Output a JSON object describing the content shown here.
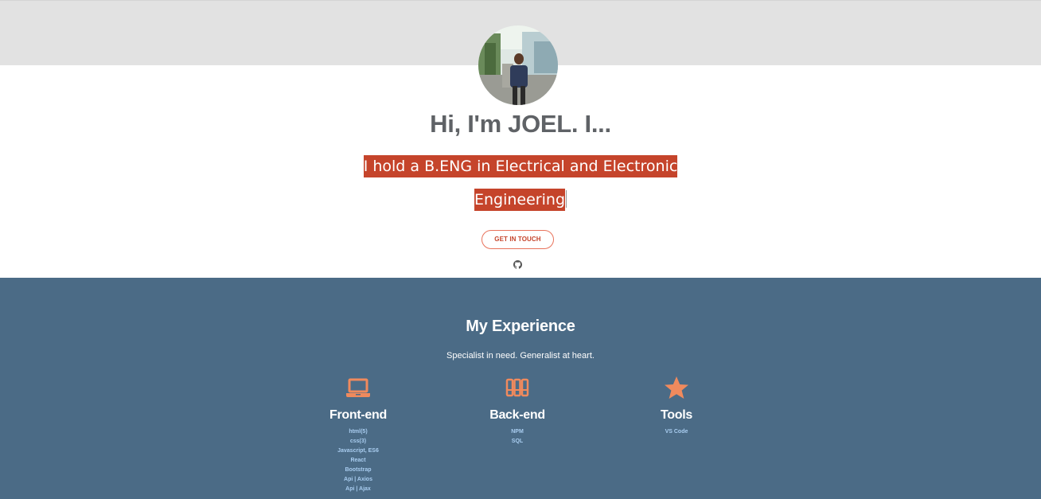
{
  "hero": {
    "greeting": "Hi, I'm JOEL. I...",
    "typed_line1": "I hold a B.ENG in Electrical and Electronic",
    "typed_line2": "Engineering",
    "cta_label": "GET IN TOUCH",
    "accent_color": "#c5442b"
  },
  "icons": {
    "avatar": "profile-photo",
    "social": "github-icon"
  },
  "experience": {
    "title": "My Experience",
    "subtitle": "Specialist in need. Generalist at heart.",
    "background": "#4b6b86",
    "columns": [
      {
        "icon": "laptop-icon",
        "heading": "Front-end",
        "items": [
          "html(5)",
          "css(3)",
          "Javascript, ES6",
          "React",
          "Bootstrap",
          "Api | Axios",
          "Api | Ajax"
        ]
      },
      {
        "icon": "server-icon",
        "heading": "Back-end",
        "items": [
          "NPM",
          "SQL"
        ]
      },
      {
        "icon": "star-icon",
        "heading": "Tools",
        "items": [
          "VS Code"
        ]
      }
    ]
  }
}
